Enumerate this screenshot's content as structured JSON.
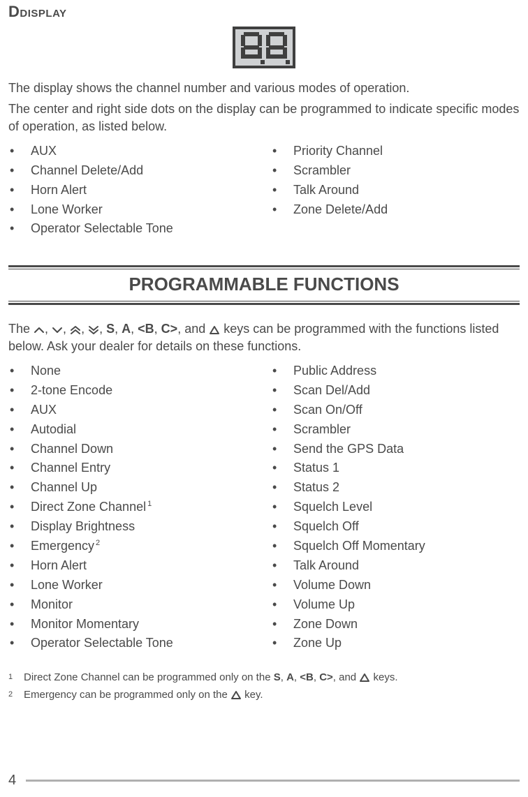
{
  "display_section": {
    "title": "Display",
    "para1": "The display shows the channel number and various modes of operation.",
    "para2": "The center and right side dots on the display can be programmed to indicate specific modes of operation, as listed below.",
    "left_items": [
      "AUX",
      "Channel Delete/Add",
      "Horn Alert",
      "Lone Worker",
      "Operator Selectable Tone"
    ],
    "right_items": [
      "Priority Channel",
      "Scrambler",
      "Talk Around",
      "Zone Delete/Add"
    ]
  },
  "prog_section": {
    "header": "PROGRAMMABLE FUNCTIONS",
    "intro_prefix": "The ",
    "intro_keys_sep": ", ",
    "intro_keys_text": [
      "S",
      "A",
      "<B",
      "C>"
    ],
    "intro_mid": ", and ",
    "intro_suffix": " keys can be programmed with the functions listed below.  Ask your dealer for details on these functions.",
    "left_items": [
      {
        "label": "None"
      },
      {
        "label": "2-tone Encode"
      },
      {
        "label": "AUX"
      },
      {
        "label": "Autodial"
      },
      {
        "label": "Channel Down"
      },
      {
        "label": "Channel Entry"
      },
      {
        "label": "Channel Up"
      },
      {
        "label": "Direct Zone Channel",
        "sup": "1"
      },
      {
        "label": "Display Brightness"
      },
      {
        "label": "Emergency",
        "sup": "2"
      },
      {
        "label": "Horn Alert"
      },
      {
        "label": "Lone Worker"
      },
      {
        "label": "Monitor"
      },
      {
        "label": "Monitor Momentary"
      },
      {
        "label": "Operator Selectable Tone"
      }
    ],
    "right_items": [
      {
        "label": "Public Address"
      },
      {
        "label": "Scan Del/Add"
      },
      {
        "label": "Scan On/Off"
      },
      {
        "label": "Scrambler"
      },
      {
        "label": "Send the GPS Data"
      },
      {
        "label": "Status 1"
      },
      {
        "label": "Status 2"
      },
      {
        "label": "Squelch Level"
      },
      {
        "label": "Squelch Off"
      },
      {
        "label": "Squelch Off Momentary"
      },
      {
        "label": "Talk Around"
      },
      {
        "label": "Volume Down"
      },
      {
        "label": "Volume Up"
      },
      {
        "label": "Zone Down"
      },
      {
        "label": "Zone Up"
      }
    ],
    "footnotes": [
      {
        "num": "1",
        "text_prefix": "Direct Zone Channel can be programmed only on the ",
        "keys": [
          "S",
          "A",
          "<B",
          "C>"
        ],
        "text_mid": ", and ",
        "text_suffix": " keys."
      },
      {
        "num": "2",
        "text_prefix": "Emergency can be programmed only on the ",
        "text_suffix": " key."
      }
    ]
  },
  "page_number": "4"
}
